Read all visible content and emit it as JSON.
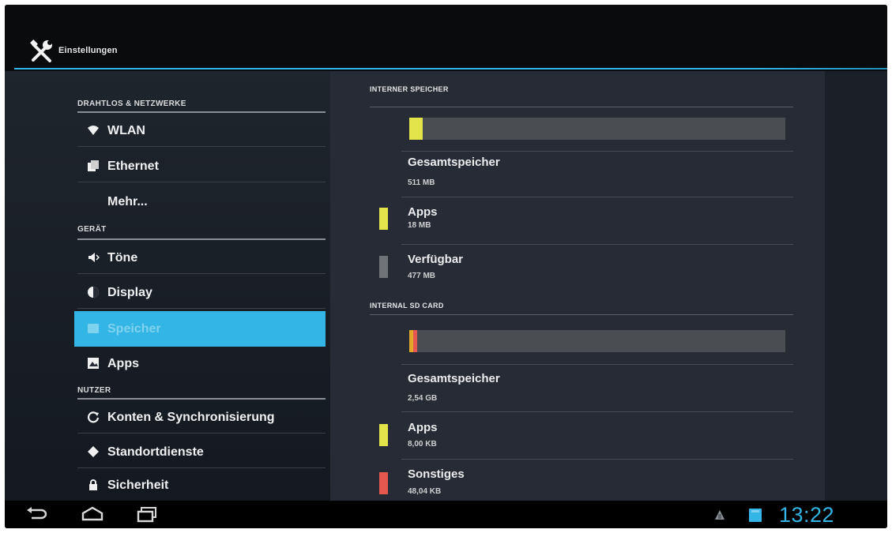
{
  "app": {
    "title": "Einstellungen",
    "icon": "tools-icon"
  },
  "nav": {
    "sections": [
      {
        "header": "DRAHTLOS & NETZWERKE"
      },
      {
        "header": "GERÄT"
      },
      {
        "header": "NUTZER"
      }
    ],
    "items": [
      {
        "label": "WLAN",
        "icon": "wifi-icon"
      },
      {
        "label": "Ethernet",
        "icon": "ethernet-icon"
      },
      {
        "label": "Mehr...",
        "icon": ""
      },
      {
        "label": "Töne",
        "icon": "speaker-icon"
      },
      {
        "label": "Display",
        "icon": "display-icon"
      },
      {
        "label": "Speicher",
        "icon": "storage-icon",
        "selected": true
      },
      {
        "label": "Apps",
        "icon": "apps-icon"
      },
      {
        "label": "Konten & Synchronisierung",
        "icon": "sync-icon"
      },
      {
        "label": "Standortdienste",
        "icon": "location-icon"
      },
      {
        "label": "Sicherheit",
        "icon": "lock-icon"
      }
    ]
  },
  "storage": {
    "internal": {
      "header": "INTERNER SPEICHER",
      "usage_fraction": 0.035,
      "total": {
        "title": "Gesamtspeicher",
        "value": "511 MB"
      },
      "apps": {
        "title": "Apps",
        "value": "18 MB",
        "color": "#e3e34a"
      },
      "free": {
        "title": "Verfügbar",
        "value": "477 MB",
        "color": "#6f7277"
      }
    },
    "sdcard": {
      "header": "INTERNAL SD CARD",
      "usage_fraction": 0.02,
      "total": {
        "title": "Gesamtspeicher",
        "value": "2,54 GB"
      },
      "apps": {
        "title": "Apps",
        "value": "8,00 KB",
        "color": "#e3e34a"
      },
      "misc": {
        "title": "Sonstiges",
        "value": "48,04 KB",
        "color": "#e5574f"
      }
    }
  },
  "systembar": {
    "buttons": [
      "back-icon",
      "home-icon",
      "recent-apps-icon"
    ],
    "clock": "13:22"
  },
  "colors": {
    "accent": "#33b5e5",
    "apps": "#e3e34a",
    "misc": "#e5574f"
  }
}
